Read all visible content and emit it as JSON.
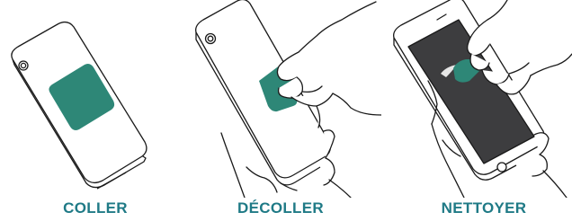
{
  "steps": [
    {
      "label": "COLLER"
    },
    {
      "label": "DÉCOLLER"
    },
    {
      "label": "NETTOYER"
    }
  ],
  "colors": {
    "sticker": "#2e8777",
    "label": "#1f7a86",
    "screen": "#3d3d3f",
    "outline": "#1a1a1a",
    "phone_fill": "#ffffff",
    "skin": "#ffffff"
  },
  "icons": [
    "phone-back-icon",
    "sticker-icon",
    "hand-icon",
    "phone-front-icon"
  ]
}
